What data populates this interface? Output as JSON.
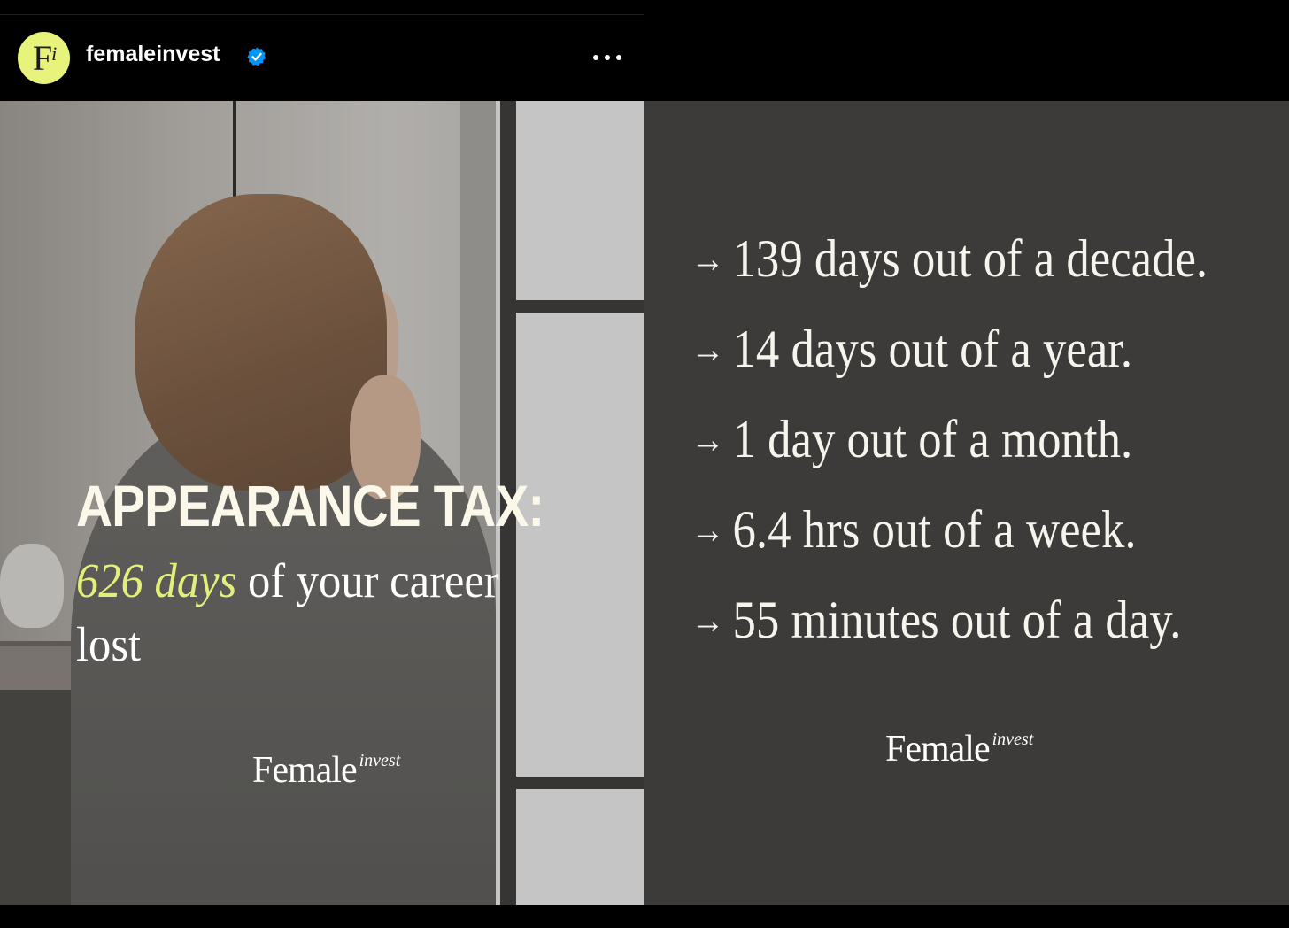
{
  "post": {
    "avatar_text": "F",
    "avatar_sup": "i",
    "username": "femaleinvest",
    "verified_icon": "verified-badge-icon",
    "more_icon": "more-options-icon"
  },
  "slide1": {
    "title": "APPEARANCE TAX:",
    "highlight": "626 days",
    "subtitle_rest": " of your career lost",
    "logo_main": "Female",
    "logo_sup": "invest"
  },
  "slide2": {
    "arrow": "→",
    "items": [
      "139 days out of a decade.",
      "14 days out of a year.",
      "1 day out of a month.",
      "6.4 hrs out of a week.",
      "55 minutes out of a day."
    ],
    "logo_main": "Female",
    "logo_sup": "invest"
  },
  "colors": {
    "accent": "#e2ef7a",
    "verified": "#0095f6",
    "panel_bg": "#3c3b39"
  }
}
